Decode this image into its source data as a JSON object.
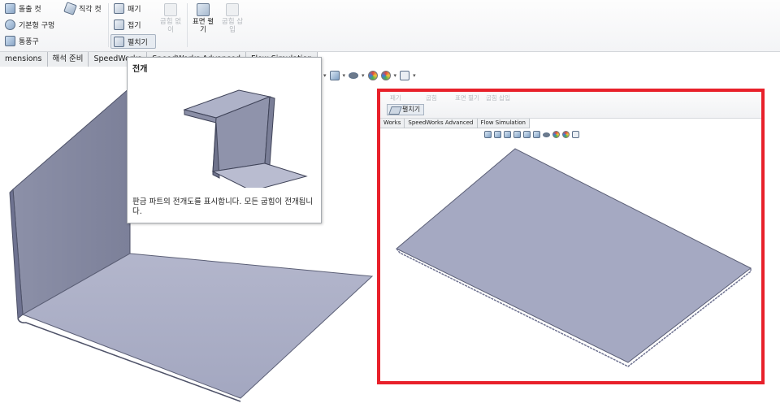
{
  "ribbon": {
    "col1": [
      "돌출 컷",
      "기본형 구멍",
      "통풍구"
    ],
    "corner_cut": "직각 컷",
    "col2": [
      "패기",
      "접기",
      "펼치기"
    ],
    "no_bend_top": "굽힘 없",
    "no_bend_bottom": "이",
    "flatten_top": "표면 펼",
    "flatten_bottom": "기",
    "insert_bend_top": "굽힘 삽",
    "insert_bend_bottom": "입"
  },
  "tabs": [
    "mensions",
    "해석 준비",
    "SpeedWorks",
    "SpeedWorks Advanced",
    "Flow Simulation"
  ],
  "tooltip": {
    "title": "전개",
    "description": "판금 파트의 전개도를 표시합니다. 모든 굽힘이 전개됩니다."
  },
  "inset": {
    "ribbon_selected": "펼치기",
    "ghost_items": [
      "패기",
      "굽힘",
      "표면 펼기",
      "굽힘 삽입"
    ],
    "tabs": [
      "Works",
      "SpeedWorks Advanced",
      "Flow Simulation"
    ]
  },
  "colors": {
    "accent_red": "#e8202a",
    "part_fill": "#a5a9c2"
  }
}
